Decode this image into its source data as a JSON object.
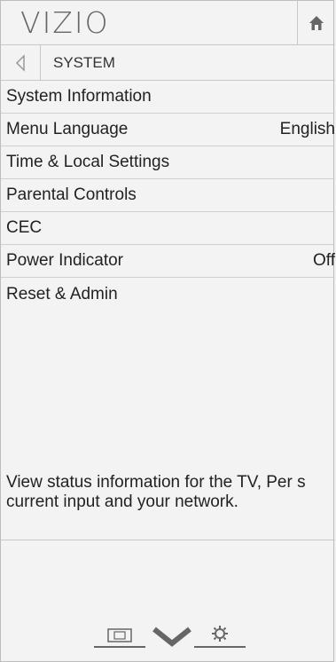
{
  "header": {
    "logo": "VIZIO",
    "home_icon": "home-icon"
  },
  "subheader": {
    "back_icon": "back-arrow-icon",
    "title": "SYSTEM"
  },
  "menu": {
    "items": [
      {
        "label": "System Information",
        "value": ""
      },
      {
        "label": "Menu Language",
        "value": "English"
      },
      {
        "label": "Time & Local Settings",
        "value": ""
      },
      {
        "label": "Parental Controls",
        "value": ""
      },
      {
        "label": "CEC",
        "value": ""
      },
      {
        "label": "Power Indicator",
        "value": "Off"
      },
      {
        "label": "Reset & Admin",
        "value": ""
      }
    ]
  },
  "description": "View status information for the TV, Per s current input and your network.",
  "bottom_bar": {
    "icons": [
      "wide-menu-icon",
      "vizio-v-icon",
      "settings-gear-icon"
    ]
  }
}
